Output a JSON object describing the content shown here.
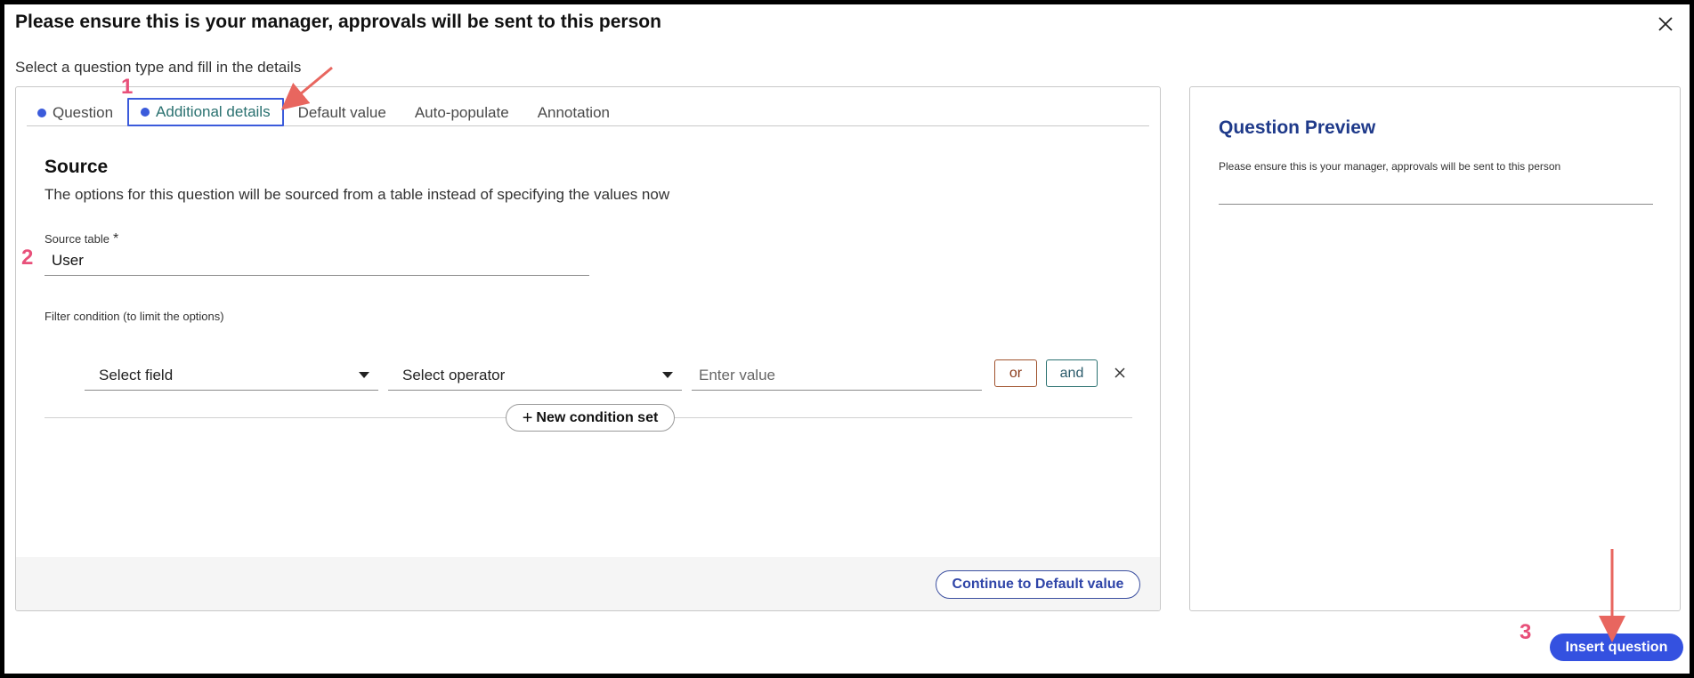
{
  "dialog": {
    "title": "Please ensure this is your manager, approvals will be sent to this person",
    "subtitle": "Select a question type and fill in the details"
  },
  "tabs": [
    {
      "label": "Question",
      "has_dot": true,
      "active": false
    },
    {
      "label": "Additional details",
      "has_dot": true,
      "active": true
    },
    {
      "label": "Default value",
      "has_dot": false,
      "active": false
    },
    {
      "label": "Auto-populate",
      "has_dot": false,
      "active": false
    },
    {
      "label": "Annotation",
      "has_dot": false,
      "active": false
    }
  ],
  "source": {
    "heading": "Source",
    "description": "The options for this question will be sourced from a table instead of specifying the values now",
    "table_label": "Source table",
    "required_marker": "*",
    "table_value": "User"
  },
  "filter": {
    "label": "Filter condition (to limit the options)",
    "field_placeholder": "Select field",
    "operator_placeholder": "Select operator",
    "value_placeholder": "Enter value",
    "or_label": "or",
    "and_label": "and",
    "new_condition_label": "New condition set"
  },
  "footer": {
    "continue_label": "Continue to Default value"
  },
  "preview": {
    "title": "Question Preview",
    "question_text": "Please ensure this is your manager, approvals will be sent to this person"
  },
  "actions": {
    "insert_label": "Insert question"
  },
  "annotations": {
    "step1": "1",
    "step2": "2",
    "step3": "3",
    "color": "#e8507a"
  },
  "colors": {
    "accent": "#3451e0",
    "tab_active_text": "#2a7170",
    "preview_title": "#1f3a8a"
  },
  "icons": {
    "close": "close-icon",
    "caret": "chevron-down-icon",
    "remove": "remove-icon",
    "plus": "plus-icon"
  }
}
